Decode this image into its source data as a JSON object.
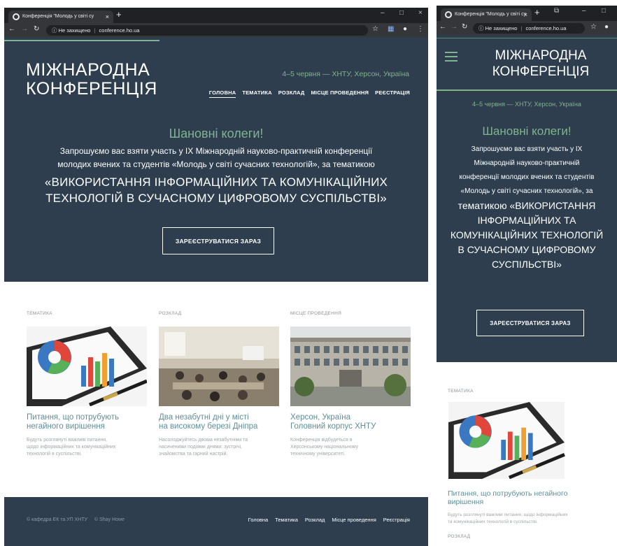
{
  "browser": {
    "tab_title": "Конференція \"Молодь у світі су",
    "tab_close": "×",
    "new_tab": "+",
    "not_secure": "Не захищено",
    "url": "conference.ho.ua",
    "window_minimize": "–",
    "window_maximize": "□",
    "window_close": "×"
  },
  "site": {
    "title_line1": "МІЖНАРОДНА",
    "title_line2": "КОНФЕРЕНЦІЯ",
    "tagline": "4–5 червня — ХНТУ, Херсон, Україна",
    "nav": [
      {
        "label": "ГОЛОВНА"
      },
      {
        "label": "ТЕМАТИКА"
      },
      {
        "label": "РОЗКЛАД"
      },
      {
        "label": "МІСЦЕ ПРОВЕДЕННЯ"
      },
      {
        "label": "РЕЄСТРАЦІЯ"
      }
    ],
    "greeting": "Шановні колеги!",
    "invite_a": "Запрошуємо вас взяти участь у IX Міжнародній науково-практичній конференції",
    "invite_b": "молодих вчених та студентів «Молодь у світі сучасних технологій», за тематикою",
    "theme_a": "«ВИКОРИСТАННЯ ІНФОРМАЦІЙНИХ ТА КОМУНІКАЦІЙНИХ",
    "theme_b": "ТЕХНОЛОГІЙ В СУЧАСНОМУ ЦИФРОВОМУ СУСПІЛЬСТВІ»",
    "register_button": "ЗАРЕЄСТРУВАТИСЯ ЗАРАЗ",
    "sections": [
      {
        "label": "ТЕМАТИКА",
        "title_line1": "Питання, що потрубують",
        "title_line2": "негайного вирішення",
        "desc_line1": "Будуть розглянуті важливі питання,",
        "desc_line2": "щодо інформаційних та комунікаційних",
        "desc_line3": "технологій в суспільстві."
      },
      {
        "label": "РОЗКЛАД",
        "title_line1": "Два незабутні дні у місті",
        "title_line2": "на високому березі Дніпра",
        "desc_line1": "Насолоджуйтесь двома незабутніми та",
        "desc_line2": "насиченими подіями днями: зустрічі,",
        "desc_line3": "знайомства та гарний настрій."
      },
      {
        "label": "МІСЦЕ ПРОВЕДЕННЯ",
        "title_line1": "Херсон, Україна",
        "title_line2": "Головний корпус ХНТУ",
        "desc_line1": "Конференція відбудеться в",
        "desc_line2": "Херсонському національному",
        "desc_line3": "технічному університеті."
      }
    ],
    "footer": {
      "copyright": "© кафедра ЕК та УП ХНТУ",
      "credit": "© Shay Howe",
      "links": [
        "Головна",
        "Тематика",
        "Розклад",
        "Місце проведення",
        "Реєстрація"
      ]
    }
  },
  "mobile": {
    "invite_lines": [
      "Запрошуємо вас взяти участь у IX",
      "Міжнародній науково-практичній",
      "конференції молодих вчених та студентів",
      "«Молодь у світі сучасних технологій», за"
    ],
    "theme_lines": [
      "тематикою «ВИКОРИСТАННЯ",
      "ІНФОРМАЦІЙНИХ ТА",
      "КОМУНІКАЦІЙНИХ ТЕХНОЛОГІЙ",
      "В СУЧАСНОМУ ЦИФРОВОМУ",
      "СУСПІЛЬСТВІ»"
    ],
    "card_title_line1": "Питання, що потрубують негайного",
    "card_title_line2": "вирішення",
    "card_desc_line1": "Будуть розглянуті важливі питання, щодо інформаційних",
    "card_desc_line2": "та комунікаційних технологій в суспільстві.",
    "next_label": "РОЗКЛАД"
  },
  "colors": {
    "hero_bg": "#2e3e4e",
    "accent_green": "#7fb48e",
    "card_title": "#5e8f97",
    "chrome_dark": "#202124"
  }
}
